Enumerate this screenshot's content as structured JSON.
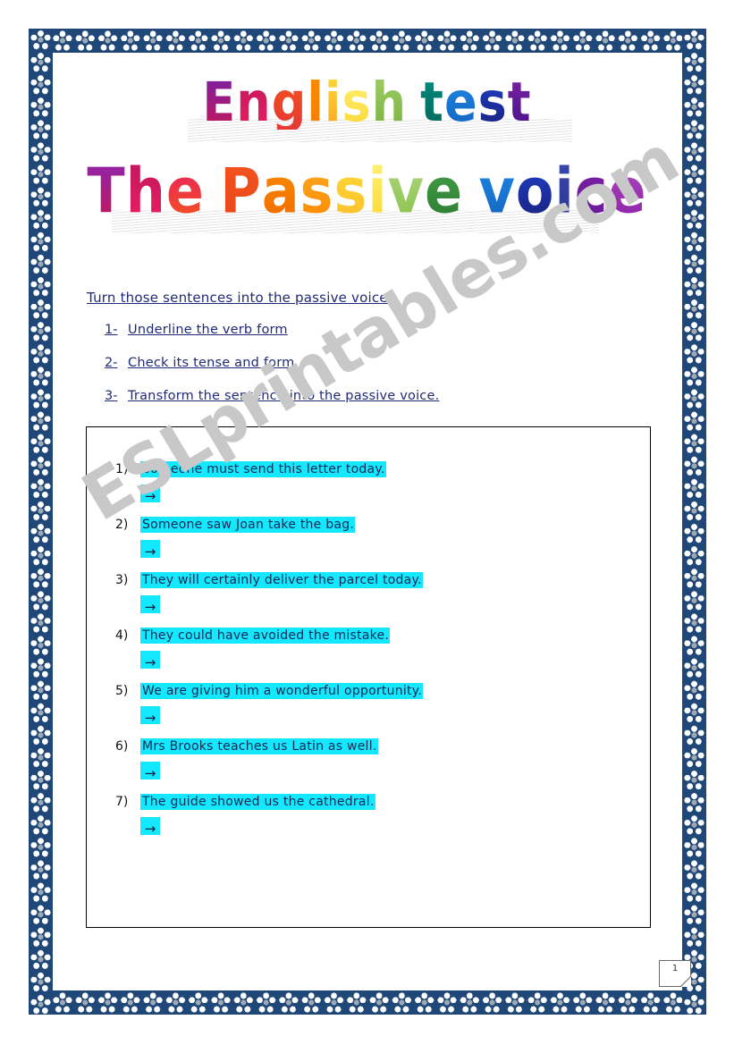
{
  "document": {
    "page_number": "1",
    "watermark": "ESLprintables.com"
  },
  "title": {
    "line1": "English test",
    "line2": "The Passive voice",
    "line1_letters": [
      {
        "ch": "E",
        "from": "#7b1fa2",
        "to": "#c2185b"
      },
      {
        "ch": "n",
        "from": "#c2185b",
        "to": "#e91e63"
      },
      {
        "ch": "g",
        "from": "#f4511e",
        "to": "#e53935"
      },
      {
        "ch": "l",
        "from": "#fb8c00",
        "to": "#f57c00"
      },
      {
        "ch": "i",
        "from": "#fdd835",
        "to": "#f9a825"
      },
      {
        "ch": "s",
        "from": "#fff176",
        "to": "#fdd835"
      },
      {
        "ch": "h",
        "from": "#9ccc65",
        "to": "#7cb342"
      },
      {
        "ch": " ",
        "from": "",
        "to": ""
      },
      {
        "ch": "t",
        "from": "#00897b",
        "to": "#00695c"
      },
      {
        "ch": "e",
        "from": "#1e88e5",
        "to": "#1565c0"
      },
      {
        "ch": "s",
        "from": "#1e3ec8",
        "to": "#1a237e"
      },
      {
        "ch": "t",
        "from": "#7b1fa2",
        "to": "#4a148c"
      }
    ],
    "line2_letters": [
      {
        "ch": "T",
        "from": "#8e24aa",
        "to": "#c2185b"
      },
      {
        "ch": "h",
        "from": "#c2185b",
        "to": "#e91e63"
      },
      {
        "ch": "e",
        "from": "#e91e63",
        "to": "#f4511e"
      },
      {
        "ch": " ",
        "from": "",
        "to": ""
      },
      {
        "ch": "P",
        "from": "#f4511e",
        "to": "#e64a19"
      },
      {
        "ch": "a",
        "from": "#fb8c00",
        "to": "#ef6c00"
      },
      {
        "ch": "s",
        "from": "#ffa726",
        "to": "#fb8c00"
      },
      {
        "ch": "s",
        "from": "#fdd835",
        "to": "#fbc02d"
      },
      {
        "ch": "i",
        "from": "#fff176",
        "to": "#fdd835"
      },
      {
        "ch": "v",
        "from": "#aed581",
        "to": "#8bc34a"
      },
      {
        "ch": "e",
        "from": "#43a047",
        "to": "#2e7d32"
      },
      {
        "ch": " ",
        "from": "",
        "to": ""
      },
      {
        "ch": "v",
        "from": "#1e88e5",
        "to": "#1565c0"
      },
      {
        "ch": "o",
        "from": "#1e3ec8",
        "to": "#1a237e"
      },
      {
        "ch": "i",
        "from": "#3949ab",
        "to": "#283593"
      },
      {
        "ch": "c",
        "from": "#7b1fa2",
        "to": "#6a1b9a"
      },
      {
        "ch": "e",
        "from": "#ab47bc",
        "to": "#8e24aa"
      }
    ]
  },
  "instructions": {
    "heading": "Turn those sentences into the passive voice:",
    "steps": [
      {
        "num": "1-",
        "text": "Underline the verb form"
      },
      {
        "num": "2-",
        "text": "Check its tense and form"
      },
      {
        "num": "3-",
        "text": "Transform the sentence into the passive voice."
      }
    ]
  },
  "exercise": {
    "arrow_symbol": "→",
    "items": [
      {
        "num": "1)",
        "sentence": "Someone must send this letter today."
      },
      {
        "num": "2)",
        "sentence": "Someone saw Joan take the bag."
      },
      {
        "num": "3)",
        "sentence": "They will certainly deliver the parcel today."
      },
      {
        "num": "4)",
        "sentence": "They could have avoided the mistake."
      },
      {
        "num": "5)",
        "sentence": "We are giving him a wonderful opportunity."
      },
      {
        "num": "6)",
        "sentence": "Mrs Brooks teaches us Latin as well."
      },
      {
        "num": "7)",
        "sentence": "The guide showed us the cathedral."
      }
    ]
  },
  "colors": {
    "border_navy": "#1f4878",
    "highlight_cyan": "#14e8ff",
    "instruction_blue": "#1f2a78",
    "watermark_gray": "#c8c8c8"
  }
}
